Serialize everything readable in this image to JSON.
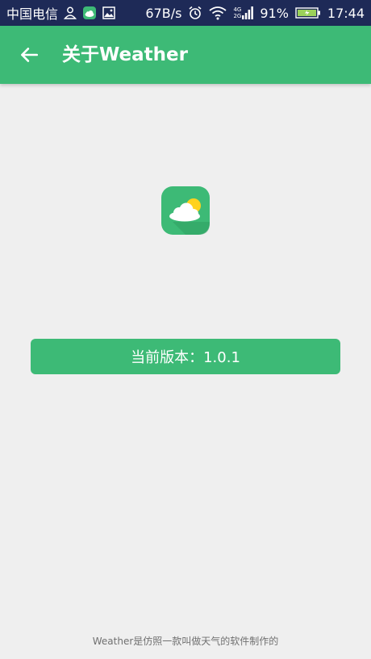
{
  "status_bar": {
    "carrier": "中国电信",
    "network_speed": "67B/s",
    "signal_top": "4G",
    "signal_bottom": "2G",
    "battery_percent": "91%",
    "time": "17:44"
  },
  "app_bar": {
    "title": "关于Weather"
  },
  "main": {
    "version_text": "当前版本：1.0.1",
    "footer_text": "Weather是仿照一款叫做天气的软件制作的"
  },
  "colors": {
    "status_bar_bg": "#1e2a57",
    "accent_green": "#3dba76",
    "page_bg": "#efefef",
    "sun_yellow": "#ffd21f"
  },
  "icons": {
    "back": "arrow-left-icon",
    "app_logo": "weather-cloud-sun-icon",
    "notification_1": "person-icon",
    "notification_2": "weather-app-icon",
    "notification_3": "image-icon",
    "alarm": "alarm-clock-icon",
    "wifi": "wifi-icon",
    "battery": "battery-charging-icon"
  }
}
